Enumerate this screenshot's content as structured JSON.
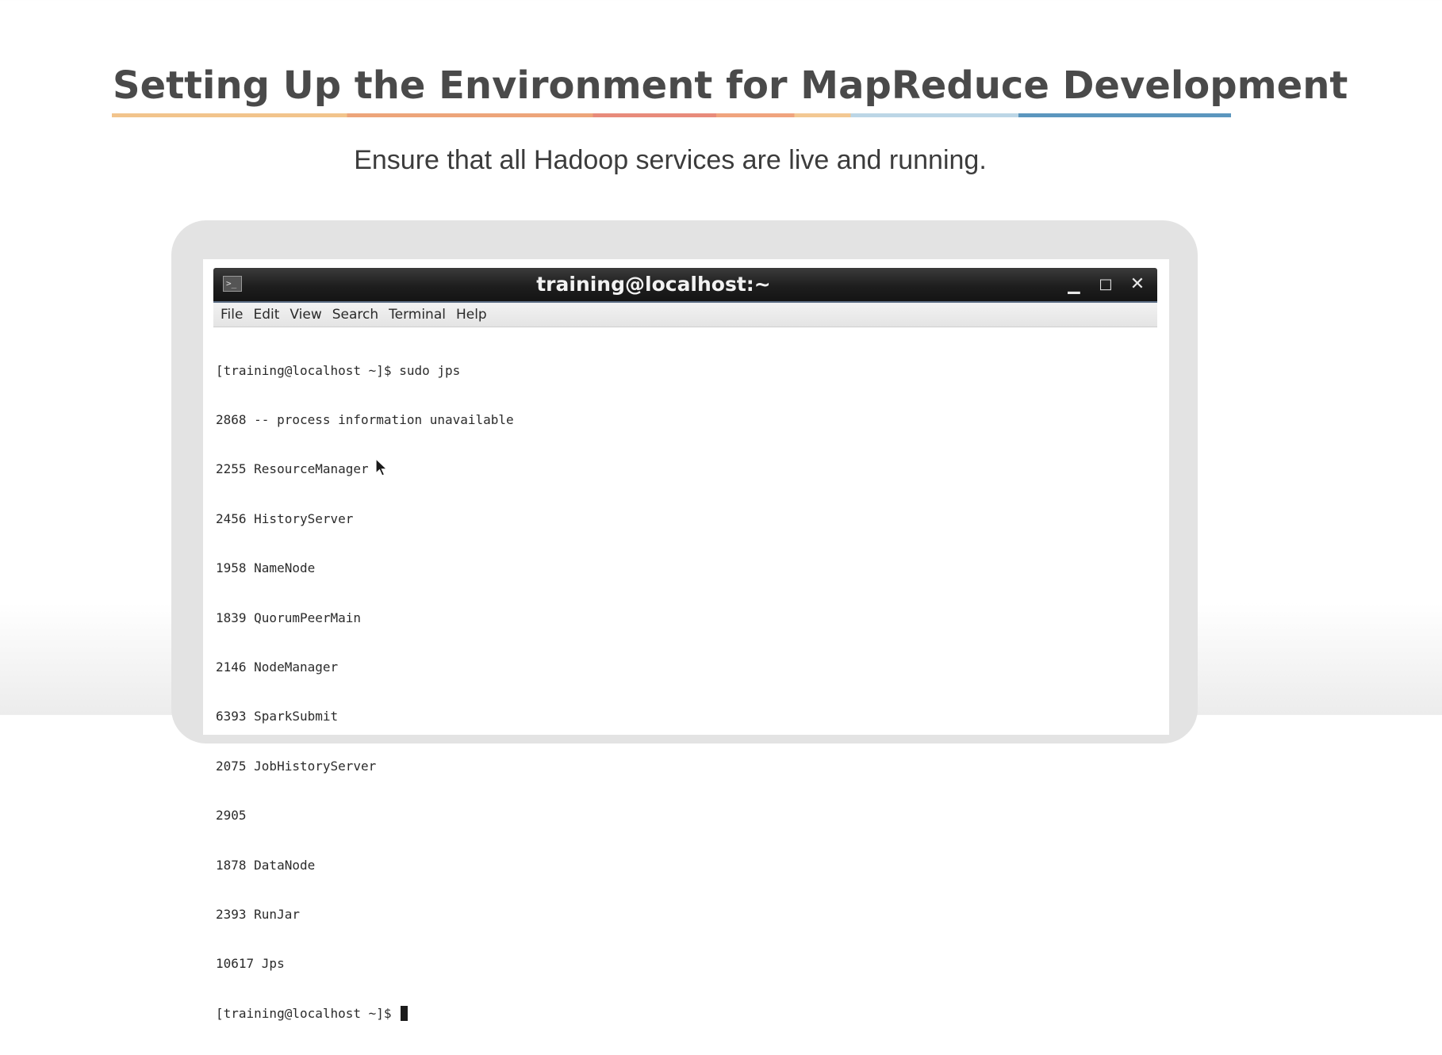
{
  "slide": {
    "title": "Setting Up the Environment for MapReduce Development",
    "subtitle": "Ensure that all Hadoop services are live and running."
  },
  "terminal": {
    "window_title": "training@localhost:~",
    "icon": "terminal-icon",
    "controls": {
      "minimize": "minimize-icon",
      "maximize": "maximize-icon",
      "close": "close-icon"
    },
    "menu": [
      "File",
      "Edit",
      "View",
      "Search",
      "Terminal",
      "Help"
    ],
    "lines": [
      "[training@localhost ~]$ sudo jps",
      "2868 -- process information unavailable",
      "2255 ResourceManager",
      "2456 HistoryServer",
      "1958 NameNode",
      "1839 QuorumPeerMain",
      "2146 NodeManager",
      "6393 SparkSubmit",
      "2075 JobHistoryServer",
      "2905",
      "1878 DataNode",
      "2393 RunJar",
      "10617 Jps"
    ],
    "prompt": "[training@localhost ~]$ "
  },
  "colors": {
    "title": "#4a4a4a",
    "titlebar": "#1e1e1e",
    "menubar": "#e9e9e9",
    "rule_accent_blue": "#5b96be",
    "rule_accent_orange": "#eda57a"
  }
}
